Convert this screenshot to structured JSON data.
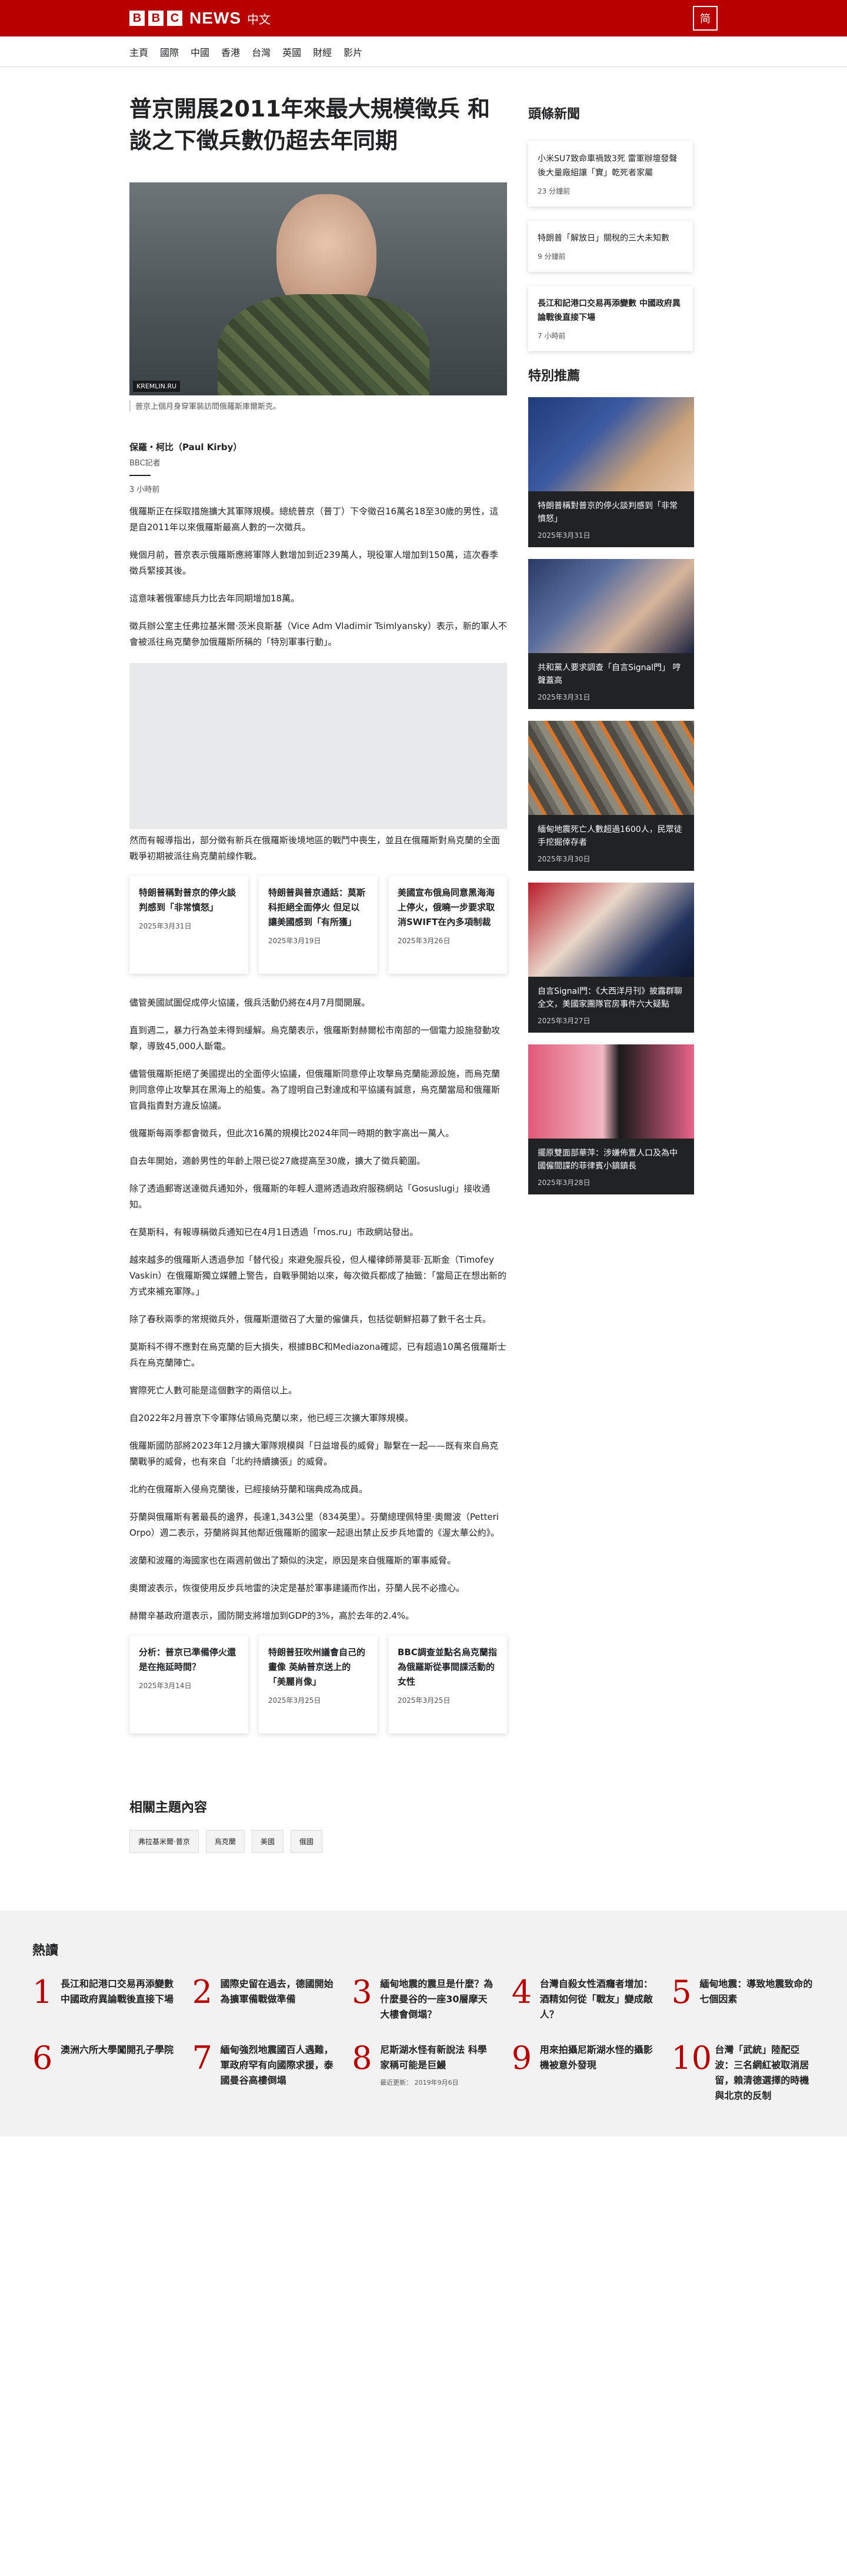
{
  "header": {
    "brand_box": [
      "B",
      "B",
      "C"
    ],
    "brand_word": "NEWS",
    "brand_sub": "中文",
    "lang_button": "简"
  },
  "nav": [
    "主頁",
    "國際",
    "中國",
    "香港",
    "台灣",
    "英國",
    "財經",
    "影片"
  ],
  "article": {
    "title": "普京開展2011年來最大規模徵兵 和談之下徵兵數仍超去年同期",
    "image_credit": "KREMLIN.RU",
    "caption": "普京上個月身穿軍裝訪問俄羅斯庫爾斯克。",
    "author": "保羅・柯比（Paul Kirby）",
    "author_role": "BBC記者",
    "time": "3 小時前",
    "paras_a": [
      "俄羅斯正在採取措施擴大其軍隊規模。總統普京（普丁）下令徵召16萬名18至30歲的男性，這是自2011年以來俄羅斯最高人數的一次徵兵。",
      "幾個月前，普京表示俄羅斯應將軍隊人數增加到近239萬人，現役軍人增加到150萬，這次春季徵兵緊接其後。",
      "這意味著俄軍總兵力比去年同期增加18萬。",
      "徵兵辦公室主任弗拉基米爾·茨米良斯基（Vice Adm Vladimir Tsimlyansky）表示，新的軍人不會被派往烏克蘭參加俄羅斯所稱的「特別軍事行動」。"
    ],
    "para_b": "然而有報導指出，部分徵有新兵在俄羅斯後境地區的戰鬥中喪生，並且在俄羅斯對烏克蘭的全面戰爭初期被派往烏克蘭前線作戰。",
    "related_a": [
      {
        "title": "特朗普稱對普京的停火談判感到「非常憤怒」",
        "date": "2025年3月31日"
      },
      {
        "title": "特朗普與普京通話：莫斯科拒絕全面停火 但足以讓美國感到「有所獲」",
        "date": "2025年3月19日"
      },
      {
        "title": "美國宣布俄烏同意黑海海上停火，俄曉一步要求取消SWIFT在內多項制裁",
        "date": "2025年3月26日"
      }
    ],
    "paras_c": [
      "儘管美國試圖促成停火協議，俄兵活動仍將在4月7月間開展。",
      "直到週二，暴力行為並未得到緩解。烏克蘭表示，俄羅斯對赫爾松市南部的一個電力設施發動攻擊，導致45,000人斷電。",
      "儘管俄羅斯拒絕了美國提出的全面停火協議，但俄羅斯同意停止攻擊烏克蘭能源設施，而烏克蘭則同意停止攻擊其在黑海上的船隻。為了證明自己對達成和平協議有誠意，烏克蘭當局和俄羅斯官員指責對方違反協議。",
      "俄羅斯每兩季都會徵兵，但此次16萬的規模比2024年同一時期的數字高出一萬人。",
      "自去年開始，適齡男性的年齡上限已從27歲提高至30歲，擴大了徵兵範圍。",
      "除了透過郵寄送達徵兵通知外，俄羅斯的年輕人還將透過政府服務網站「Gosuslugi」接收通知。",
      "在莫斯科，有報導稱徵兵通知已在4月1日透過「mos.ru」市政網站發出。",
      "越來越多的俄羅斯人透過參加「替代役」來避免服兵役，但人權律師蒂莫菲·瓦斯金（Timofey Vaskin）在俄羅斯獨立媒體上警告，自戰爭開始以來，每次徵兵都成了抽籤：「當局正在想出新的方式來補充軍隊。」",
      "除了春秋兩季的常規徵兵外，俄羅斯還徵召了大量的僱傭兵，包括從朝鮮招募了數千名士兵。",
      "莫斯科不得不應對在烏克蘭的巨大損失，根據BBC和Mediazona確認，已有超過10萬名俄羅斯士兵在烏克蘭陣亡。",
      "實際死亡人數可能是這個數字的兩倍以上。",
      "自2022年2月普京下令軍隊佔領烏克蘭以來，他已經三次擴大軍隊規模。",
      "俄羅斯國防部將2023年12月擴大軍隊規模與「日益增長的威脅」聯繫在一起——既有來自烏克蘭戰爭的威脅，也有來自「北約持續擴張」的威脅。",
      "北約在俄羅斯入侵烏克蘭後，已經接納芬蘭和瑞典成為成員。",
      "芬蘭與俄羅斯有著最長的邊界，長達1,343公里（834英里）。芬蘭總理佩特里·奧爾波（Petteri Orpo）週二表示，芬蘭將與其他鄰近俄羅斯的國家一起退出禁止反步兵地雷的《渥太華公約》。",
      "波蘭和波羅的海國家也在兩週前做出了類似的決定，原因是來自俄羅斯的軍事威脅。",
      "奧爾波表示，恢復使用反步兵地雷的決定是基於軍事建議而作出，芬蘭人民不必擔心。",
      "赫爾辛基政府還表示，國防開支將增加到GDP的3%，高於去年的2.4%。"
    ],
    "related_b": [
      {
        "title": "分析：普京已準備停火還是在拖延時間？",
        "date": "2025年3月14日"
      },
      {
        "title": "特朗普狂吹州議會自己的畫像 英納普京送上的「美麗肖像」",
        "date": "2025年3月25日"
      },
      {
        "title": "BBC調查並點名烏克蘭指為俄羅斯從事間諜活動的女性",
        "date": "2025年3月25日"
      }
    ]
  },
  "sidebar": {
    "top_title": "頭條新聞",
    "top_items": [
      {
        "title": "小米SU7致命車禍致3死 雷軍辦壇發聲後大量廠組讓「實」乾死者家屬",
        "date": "23 分鐘前",
        "bold": false
      },
      {
        "title": "特朗普「解放日」關稅的三大未知數",
        "date": "9 分鐘前",
        "bold": false
      },
      {
        "title": "長江和記港口交易再添變數 中國政府異論戰後直接下場",
        "date": "7 小時前",
        "bold": true
      }
    ],
    "rec_title": "特別推薦",
    "rec_items": [
      {
        "title": "特朗普稱對普京的停火談判感到「非常憤怒」",
        "date": "2025年3月31日"
      },
      {
        "title": "共和黨人要求調查「自言Signal門」 哼聲蓋高",
        "date": "2025年3月31日"
      },
      {
        "title": "緬甸地震死亡人數超過1600人，民眾徒手挖掘倖存者",
        "date": "2025年3月30日"
      },
      {
        "title": "自言Signal門：《大西洋月刊》披露群聊全文，美國家團隊官房事件六大疑點",
        "date": "2025年3月27日"
      },
      {
        "title": "擺原雙面部華萍：涉嫌佈置人口及為中國僱間諜的菲律賓小鎮鎮長",
        "date": "2025年3月28日"
      }
    ]
  },
  "topics": {
    "title": "相關主題內容",
    "tags": [
      "弗拉基米爾·普京",
      "烏克蘭",
      "美國",
      "俄國"
    ]
  },
  "trending": {
    "title": "熱讀",
    "items": [
      {
        "num": "1",
        "title": "長江和記港口交易再添變數 中國政府異論戰後直接下場",
        "date": ""
      },
      {
        "num": "2",
        "title": "國際史留在過去，德國開始為擴軍備戰做準備",
        "date": ""
      },
      {
        "num": "3",
        "title": "緬甸地震的震旦是什麼？為什麼曼谷的一座30層摩天大樓會倒塌？",
        "date": ""
      },
      {
        "num": "4",
        "title": "台灣自殺女性酒癮者增加：酒精如何從「戰友」變成敵人？",
        "date": ""
      },
      {
        "num": "5",
        "title": "緬甸地震：導致地震致命的七個因素",
        "date": ""
      },
      {
        "num": "6",
        "title": "澳洲六所大學闖開孔子學院",
        "date": ""
      },
      {
        "num": "7",
        "title": "緬甸強烈地震國百人遇難，軍政府罕有向國際求援，泰國曼谷高樓倒塌",
        "date": ""
      },
      {
        "num": "8",
        "title": "尼斯湖水怪有新說法 科學家稱可能是巨鰻",
        "date": "最近更新： 2019年9月6日"
      },
      {
        "num": "9",
        "title": "用來拍攝尼斯湖水怪的攝影機被意外發現",
        "date": ""
      },
      {
        "num": "10",
        "title": "台灣「武統」陸配亞波：三名網紅被取消居留，賴清德選擇的時機與北京的反制",
        "date": ""
      }
    ]
  }
}
